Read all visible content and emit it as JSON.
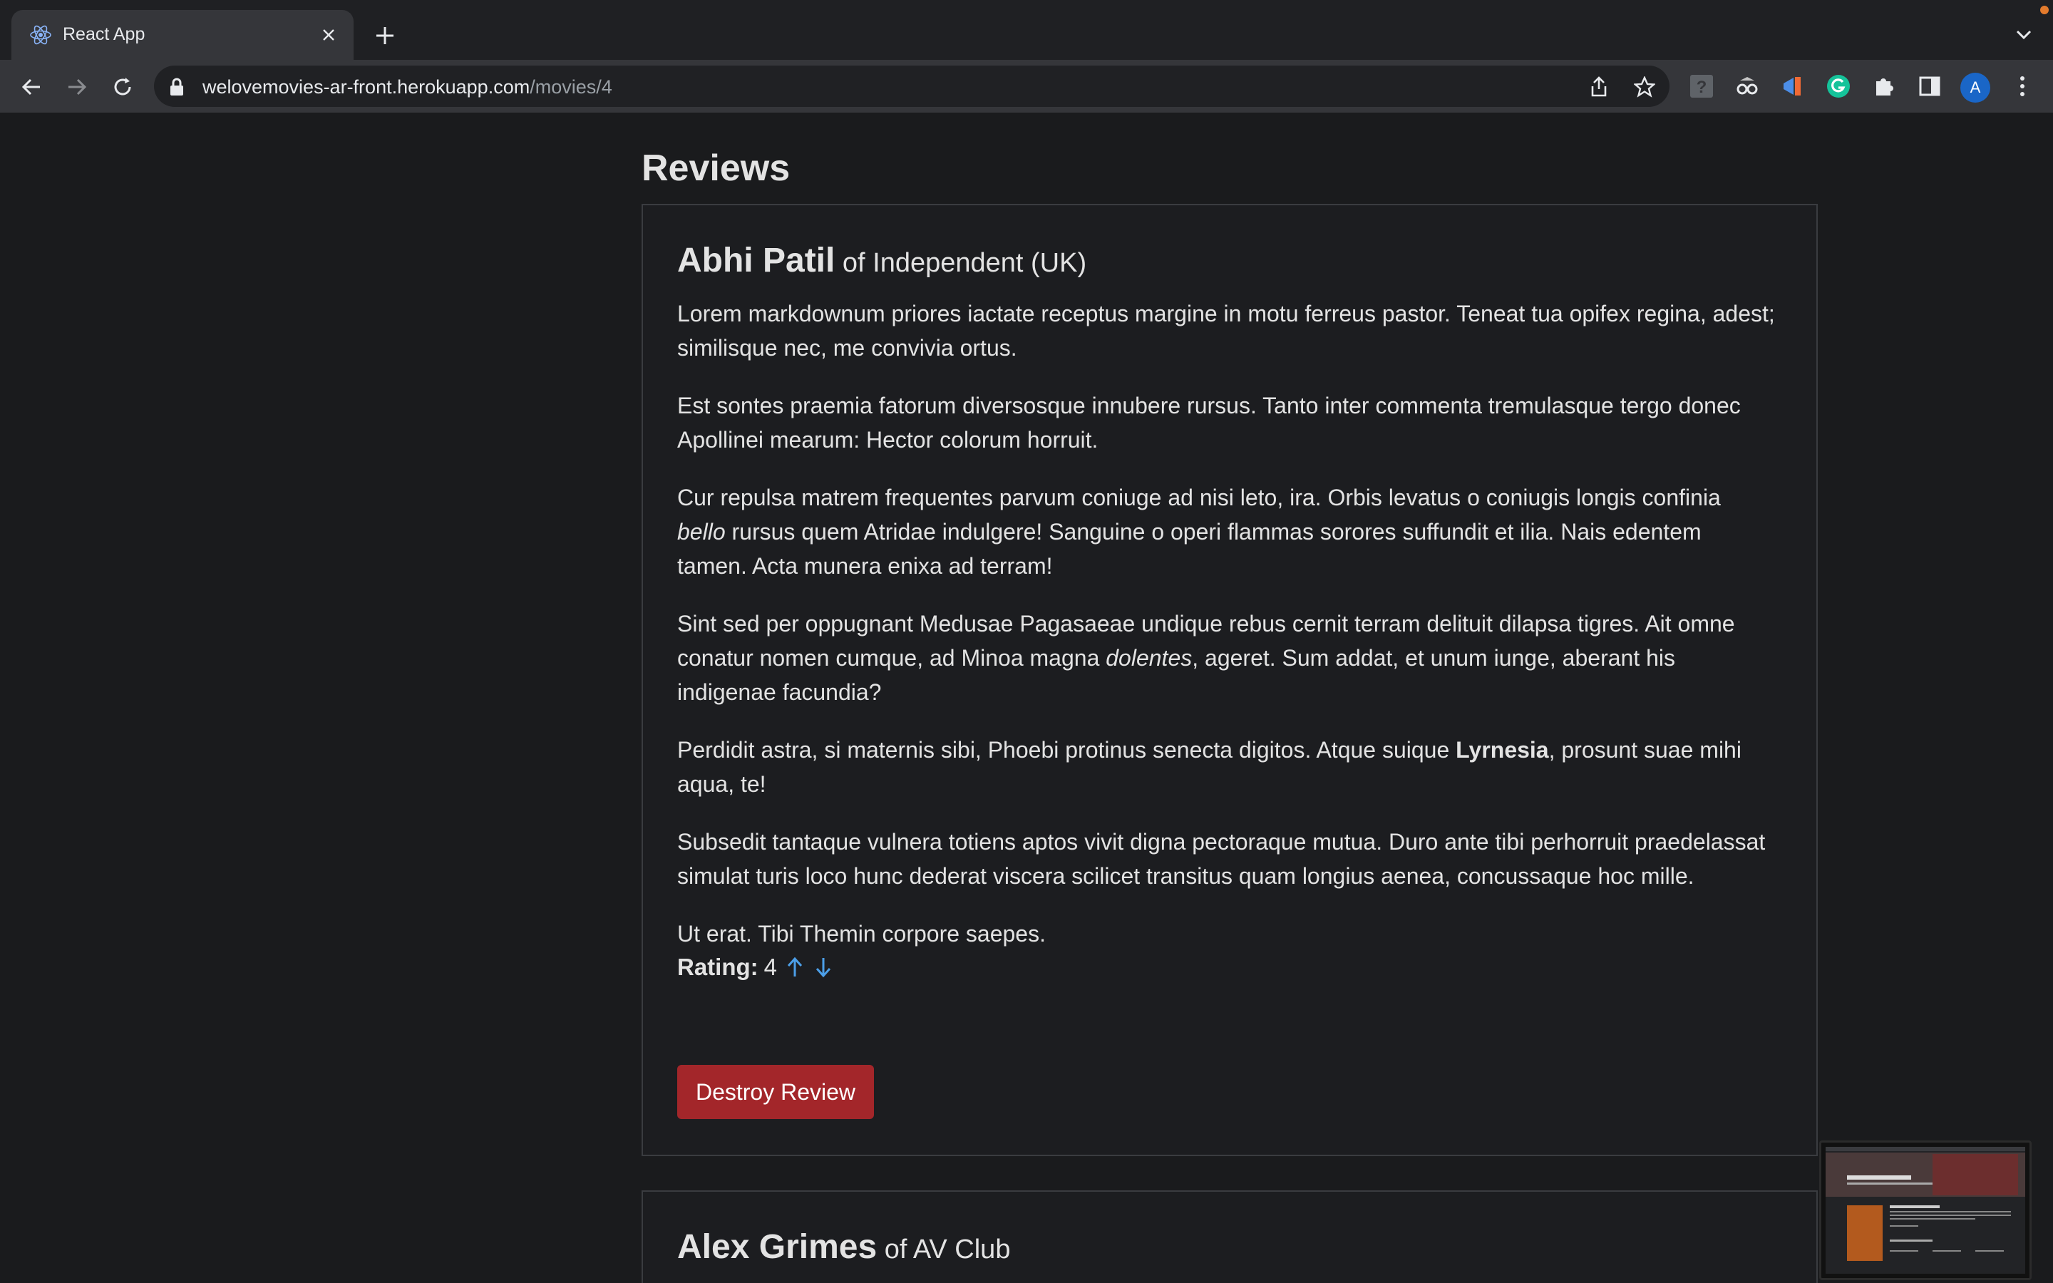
{
  "browser": {
    "tab_title": "React App",
    "url_host": "welovemovies-ar-front.herokuapp.com",
    "url_path": "/movies/4",
    "profile_initial": "A"
  },
  "page": {
    "heading": "Reviews",
    "reviews": [
      {
        "critic_name": "Abhi Patil",
        "critic_org": " of Independent (UK)",
        "paragraphs": [
          "Lorem markdownum priores iactate receptus margine in motu ferreus pastor. Teneat tua opifex regina, adest; similisque nec, me convivia ortus.",
          "Est sontes praemia fatorum diversosque innubere rursus. Tanto inter commenta tremulasque tergo donec Apollinei mearum: Hector colorum horruit.",
          {
            "before": "Cur repulsa matrem frequentes parvum coniuge ad nisi leto, ira. Orbis levatus o coniugis longis confinia ",
            "em": "bello",
            "after": " rursus quem Atridae indulgere! Sanguine o operi flammas sorores suffundit et ilia. Nais edentem tamen. Acta munera enixa ad terram!"
          },
          {
            "before": "Sint sed per oppugnant Medusae Pagasaeae undique rebus cernit terram delituit dilapsa tigres. Ait omne conatur nomen cumque, ad Minoa magna ",
            "em": "dolentes",
            "after": ", ageret. Sum addat, et unum iunge, aberant his indigenae facundia?"
          },
          {
            "before": "Perdidit astra, si maternis sibi, Phoebi protinus senecta digitos. Atque suique ",
            "strong": "Lyrnesia",
            "after": ", prosunt suae mihi aqua, te!"
          },
          "Subsedit tantaque vulnera totiens aptos vivit digna pectoraque mutua. Duro ante tibi perhorruit praedelassat simulat turis loco hunc dederat viscera scilicet transitus quam longius aenea, concussaque hoc mille.",
          "Ut erat. Tibi Themin corpore saepes."
        ],
        "rating_label": "Rating:",
        "rating_value": "4",
        "destroy_label": "Destroy Review"
      },
      {
        "critic_name": "Alex Grimes",
        "critic_org": " of AV Club"
      }
    ]
  },
  "colors": {
    "accent_blue": "#4c9fe8",
    "destroy_red": "#a3262a",
    "background": "#1a1b1d"
  },
  "icons": {
    "upvote": "arrow-up-icon",
    "downvote": "arrow-down-icon"
  }
}
